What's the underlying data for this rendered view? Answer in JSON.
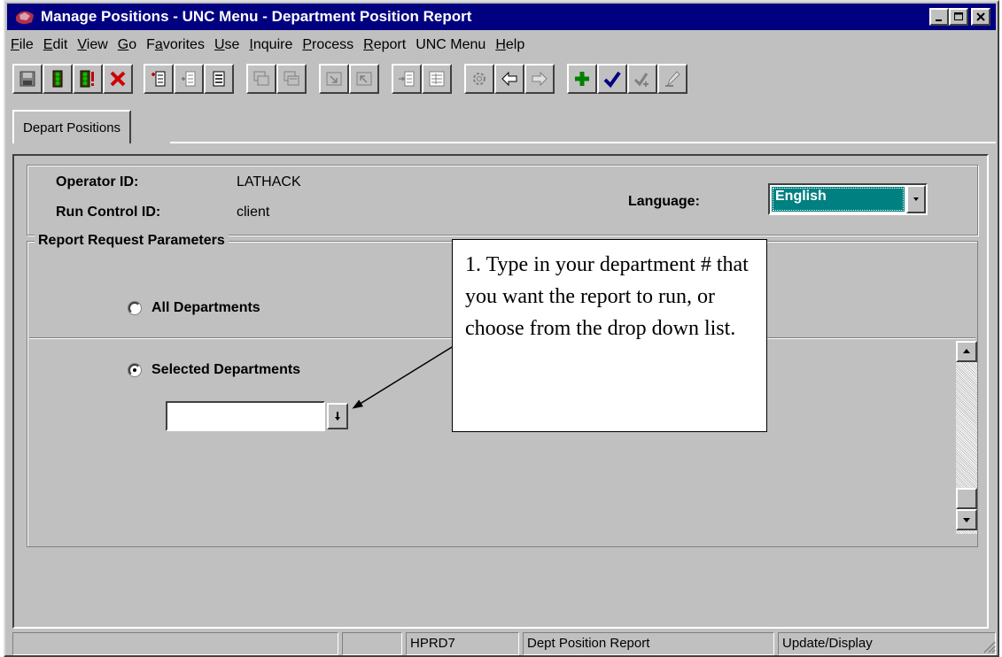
{
  "window": {
    "title": "Manage Positions - UNC Menu - Department Position Report",
    "minimize": "_",
    "maximize": "□",
    "close": "×"
  },
  "menu": [
    {
      "pre": "",
      "acc": "F",
      "post": "ile"
    },
    {
      "pre": "",
      "acc": "E",
      "post": "dit"
    },
    {
      "pre": "",
      "acc": "V",
      "post": "iew"
    },
    {
      "pre": "",
      "acc": "G",
      "post": "o"
    },
    {
      "pre": "F",
      "acc": "a",
      "post": "vorites"
    },
    {
      "pre": "",
      "acc": "U",
      "post": "se"
    },
    {
      "pre": "",
      "acc": "I",
      "post": "nquire"
    },
    {
      "pre": "",
      "acc": "P",
      "post": "rocess"
    },
    {
      "pre": "",
      "acc": "R",
      "post": "eport"
    },
    {
      "pre": "",
      "acc": "",
      "post": "UNC Menu"
    },
    {
      "pre": "",
      "acc": "H",
      "post": "elp"
    }
  ],
  "tab": {
    "label": "Depart Positions"
  },
  "operator": {
    "label": "Operator ID:",
    "value": "LATHACK"
  },
  "run_control": {
    "label": "Run Control ID:",
    "value": "client"
  },
  "language": {
    "label": "Language:",
    "value": "English"
  },
  "report_params": {
    "title": "Report Request Parameters",
    "all_departments": "All Departments",
    "selected_departments": "Selected Departments",
    "selected_option": "Selected Departments",
    "department_value": ""
  },
  "callout": {
    "text": "1. Type in your department # that you want the report to run, or choose from the drop down list."
  },
  "status": {
    "field1": "",
    "db": "HPRD7",
    "page": "Dept Position Report",
    "mode": "Update/Display"
  },
  "colors": {
    "title_bar": "#000080",
    "window_bg": "#c0c0c0",
    "selection": "#008080"
  }
}
